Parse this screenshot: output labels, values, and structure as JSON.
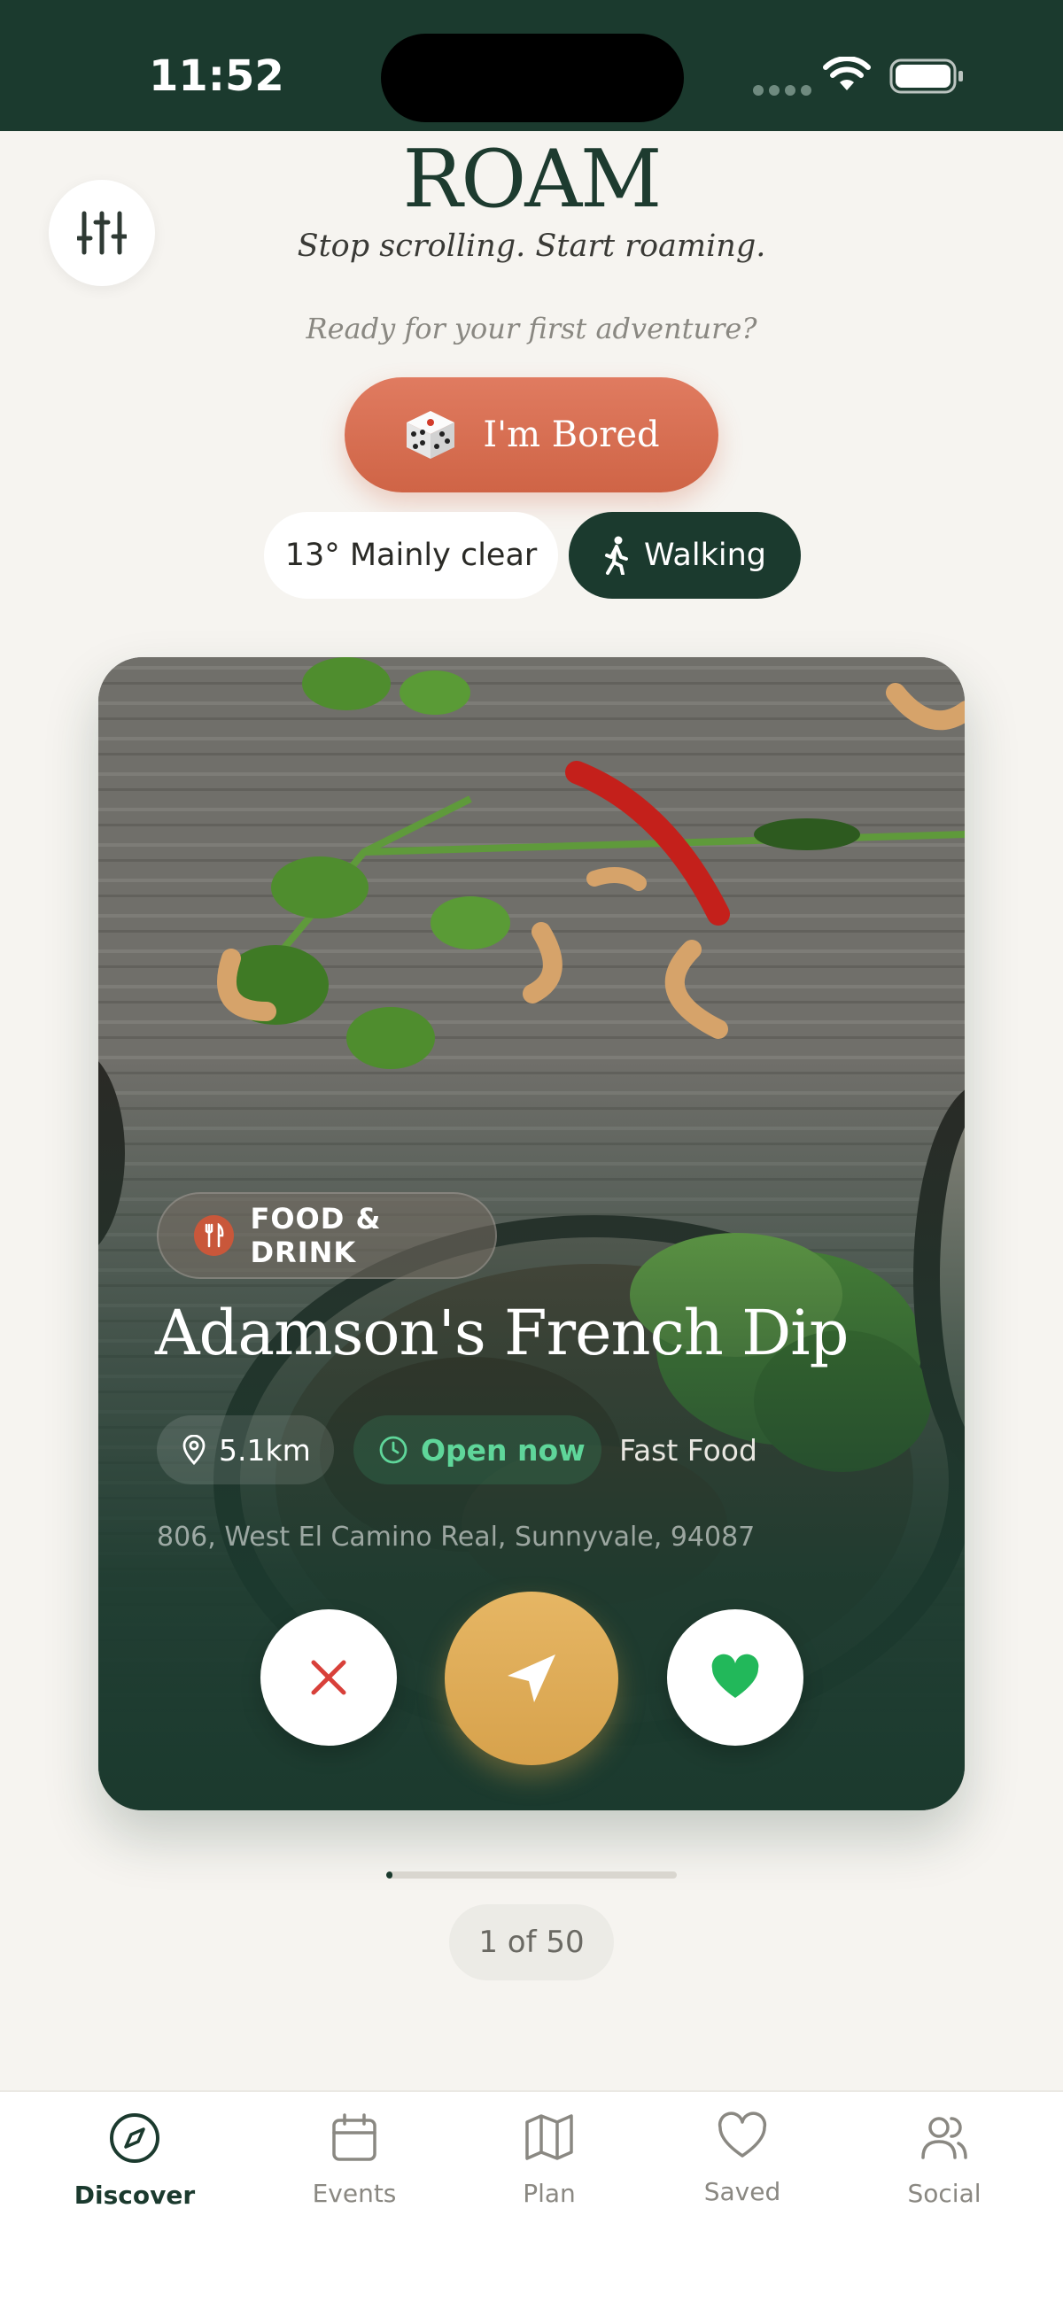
{
  "status_bar": {
    "time": "11:52"
  },
  "header": {
    "brand": "ROAM",
    "tagline": "Stop scrolling. Start roaming.",
    "prompt": "Ready for your first adventure?",
    "bored_label": "I'm Bored"
  },
  "chips": {
    "weather": "13° Mainly clear",
    "mode": "Walking"
  },
  "card": {
    "category": "FOOD & DRINK",
    "name": "Adamson's French Dip",
    "distance": "5.1km",
    "open_status": "Open now",
    "cuisine": "Fast Food",
    "address": "806, West El Camino Real, Sunnyvale, 94087"
  },
  "pager": {
    "progress_fraction": 0.02,
    "counter": "1 of 50"
  },
  "tabs": [
    {
      "label": "Discover",
      "icon": "compass-icon",
      "active": true
    },
    {
      "label": "Events",
      "icon": "calendar-icon",
      "active": false
    },
    {
      "label": "Plan",
      "icon": "map-icon",
      "active": false
    },
    {
      "label": "Saved",
      "icon": "heart-icon",
      "active": false
    },
    {
      "label": "Social",
      "icon": "users-icon",
      "active": false
    }
  ],
  "colors": {
    "brand_green": "#1b3a2e",
    "accent_coral": "#d96d50",
    "accent_gold": "#ddaa57",
    "open_green": "#5fd69a",
    "pass_red": "#d8403a",
    "like_green": "#22b85a"
  }
}
